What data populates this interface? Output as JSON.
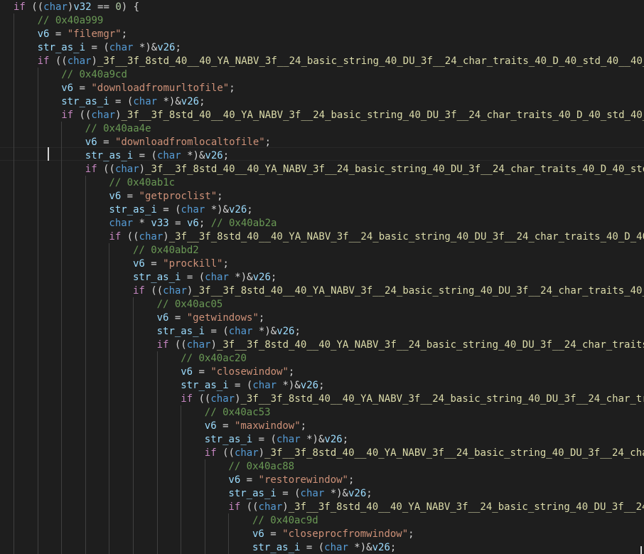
{
  "editor": {
    "colors": {
      "background": "#1e1e1e",
      "keyword": "#c586c0",
      "type": "#569cd6",
      "variable": "#9cdcfe",
      "string": "#ce9178",
      "number": "#b5cea8",
      "comment": "#6a9955",
      "function": "#dcdcaa"
    },
    "lines": [
      [
        {
          "k": "kw",
          "t": "if"
        },
        {
          "k": "p",
          "t": " (("
        },
        {
          "k": "ty",
          "t": "char"
        },
        {
          "k": "p",
          "t": ")"
        },
        {
          "k": "var",
          "t": "v32"
        },
        {
          "k": "p",
          "t": " == "
        },
        {
          "k": "num",
          "t": "0"
        },
        {
          "k": "p",
          "t": ") {"
        }
      ],
      [
        {
          "k": "cmt",
          "t": "// 0x40a999"
        }
      ],
      [
        {
          "k": "var",
          "t": "v6"
        },
        {
          "k": "p",
          "t": " = "
        },
        {
          "k": "str",
          "t": "\"filemgr\""
        },
        {
          "k": "p",
          "t": ";"
        }
      ],
      [
        {
          "k": "var",
          "t": "str_as_i"
        },
        {
          "k": "p",
          "t": " = ("
        },
        {
          "k": "ty",
          "t": "char"
        },
        {
          "k": "p",
          "t": " *)&"
        },
        {
          "k": "var",
          "t": "v26"
        },
        {
          "k": "p",
          "t": ";"
        }
      ],
      [
        {
          "k": "kw",
          "t": "if"
        },
        {
          "k": "p",
          "t": " (("
        },
        {
          "k": "ty",
          "t": "char"
        },
        {
          "k": "p",
          "t": ")"
        },
        {
          "k": "fn",
          "t": "_3f__3f_8std_40__40_YA_NABV_3f__24_basic_string_40_DU_3f__24_char_traits_40_D_40_std_40__40_"
        }
      ],
      [
        {
          "k": "cmt",
          "t": "// 0x40a9cd"
        }
      ],
      [
        {
          "k": "var",
          "t": "v6"
        },
        {
          "k": "p",
          "t": " = "
        },
        {
          "k": "str",
          "t": "\"downloadfromurltofile\""
        },
        {
          "k": "p",
          "t": ";"
        }
      ],
      [
        {
          "k": "var",
          "t": "str_as_i"
        },
        {
          "k": "p",
          "t": " = ("
        },
        {
          "k": "ty",
          "t": "char"
        },
        {
          "k": "p",
          "t": " *)&"
        },
        {
          "k": "var",
          "t": "v26"
        },
        {
          "k": "p",
          "t": ";"
        }
      ],
      [
        {
          "k": "kw",
          "t": "if"
        },
        {
          "k": "p",
          "t": " (("
        },
        {
          "k": "ty",
          "t": "char"
        },
        {
          "k": "p",
          "t": ")"
        },
        {
          "k": "fn",
          "t": "_3f__3f_8std_40__40_YA_NABV_3f__24_basic_string_40_DU_3f__24_char_traits_40_D_40_std_40_"
        }
      ],
      [
        {
          "k": "cmt",
          "t": "// 0x40aa4e"
        }
      ],
      [
        {
          "k": "var",
          "t": "v6"
        },
        {
          "k": "p",
          "t": " = "
        },
        {
          "k": "str",
          "t": "\"downloadfromlocaltofile\""
        },
        {
          "k": "p",
          "t": ";"
        }
      ],
      [
        {
          "k": "var",
          "t": "str_as_i"
        },
        {
          "k": "p",
          "t": " = ("
        },
        {
          "k": "ty",
          "t": "char"
        },
        {
          "k": "p",
          "t": " *)&"
        },
        {
          "k": "var",
          "t": "v26"
        },
        {
          "k": "p",
          "t": ";"
        }
      ],
      [
        {
          "k": "kw",
          "t": "if"
        },
        {
          "k": "p",
          "t": " (("
        },
        {
          "k": "ty",
          "t": "char"
        },
        {
          "k": "p",
          "t": ")"
        },
        {
          "k": "fn",
          "t": "_3f__3f_8std_40__40_YA_NABV_3f__24_basic_string_40_DU_3f__24_char_traits_40_D_40_sto"
        }
      ],
      [
        {
          "k": "cmt",
          "t": "// 0x40ab1c"
        }
      ],
      [
        {
          "k": "var",
          "t": "v6"
        },
        {
          "k": "p",
          "t": " = "
        },
        {
          "k": "str",
          "t": "\"getproclist\""
        },
        {
          "k": "p",
          "t": ";"
        }
      ],
      [
        {
          "k": "var",
          "t": "str_as_i"
        },
        {
          "k": "p",
          "t": " = ("
        },
        {
          "k": "ty",
          "t": "char"
        },
        {
          "k": "p",
          "t": " *)&"
        },
        {
          "k": "var",
          "t": "v26"
        },
        {
          "k": "p",
          "t": ";"
        }
      ],
      [
        {
          "k": "ty",
          "t": "char"
        },
        {
          "k": "p",
          "t": " * "
        },
        {
          "k": "var",
          "t": "v33"
        },
        {
          "k": "p",
          "t": " = "
        },
        {
          "k": "var",
          "t": "v6"
        },
        {
          "k": "p",
          "t": "; "
        },
        {
          "k": "cmt",
          "t": "// 0x40ab2a"
        }
      ],
      [
        {
          "k": "kw",
          "t": "if"
        },
        {
          "k": "p",
          "t": " (("
        },
        {
          "k": "ty",
          "t": "char"
        },
        {
          "k": "p",
          "t": ")"
        },
        {
          "k": "fn",
          "t": "_3f__3f_8std_40__40_YA_NABV_3f__24_basic_string_40_DU_3f__24_char_traits_40_D_40"
        }
      ],
      [
        {
          "k": "cmt",
          "t": "// 0x40abd2"
        }
      ],
      [
        {
          "k": "var",
          "t": "v6"
        },
        {
          "k": "p",
          "t": " = "
        },
        {
          "k": "str",
          "t": "\"prockill\""
        },
        {
          "k": "p",
          "t": ";"
        }
      ],
      [
        {
          "k": "var",
          "t": "str_as_i"
        },
        {
          "k": "p",
          "t": " = ("
        },
        {
          "k": "ty",
          "t": "char"
        },
        {
          "k": "p",
          "t": " *)&"
        },
        {
          "k": "var",
          "t": "v26"
        },
        {
          "k": "p",
          "t": ";"
        }
      ],
      [
        {
          "k": "kw",
          "t": "if"
        },
        {
          "k": "p",
          "t": " (("
        },
        {
          "k": "ty",
          "t": "char"
        },
        {
          "k": "p",
          "t": ")"
        },
        {
          "k": "fn",
          "t": "_3f__3f_8std_40__40_YA_NABV_3f__24_basic_string_40_DU_3f__24_char_traits_40_"
        }
      ],
      [
        {
          "k": "cmt",
          "t": "// 0x40ac05"
        }
      ],
      [
        {
          "k": "var",
          "t": "v6"
        },
        {
          "k": "p",
          "t": " = "
        },
        {
          "k": "str",
          "t": "\"getwindows\""
        },
        {
          "k": "p",
          "t": ";"
        }
      ],
      [
        {
          "k": "var",
          "t": "str_as_i"
        },
        {
          "k": "p",
          "t": " = ("
        },
        {
          "k": "ty",
          "t": "char"
        },
        {
          "k": "p",
          "t": " *)&"
        },
        {
          "k": "var",
          "t": "v26"
        },
        {
          "k": "p",
          "t": ";"
        }
      ],
      [
        {
          "k": "kw",
          "t": "if"
        },
        {
          "k": "p",
          "t": " (("
        },
        {
          "k": "ty",
          "t": "char"
        },
        {
          "k": "p",
          "t": ")"
        },
        {
          "k": "fn",
          "t": "_3f__3f_8std_40__40_YA_NABV_3f__24_basic_string_40_DU_3f__24_char_traits"
        }
      ],
      [
        {
          "k": "cmt",
          "t": "// 0x40ac20"
        }
      ],
      [
        {
          "k": "var",
          "t": "v6"
        },
        {
          "k": "p",
          "t": " = "
        },
        {
          "k": "str",
          "t": "\"closewindow\""
        },
        {
          "k": "p",
          "t": ";"
        }
      ],
      [
        {
          "k": "var",
          "t": "str_as_i"
        },
        {
          "k": "p",
          "t": " = ("
        },
        {
          "k": "ty",
          "t": "char"
        },
        {
          "k": "p",
          "t": " *)&"
        },
        {
          "k": "var",
          "t": "v26"
        },
        {
          "k": "p",
          "t": ";"
        }
      ],
      [
        {
          "k": "kw",
          "t": "if"
        },
        {
          "k": "p",
          "t": " (("
        },
        {
          "k": "ty",
          "t": "char"
        },
        {
          "k": "p",
          "t": ")"
        },
        {
          "k": "fn",
          "t": "_3f__3f_8std_40__40_YA_NABV_3f__24_basic_string_40_DU_3f__24_char_tr"
        }
      ],
      [
        {
          "k": "cmt",
          "t": "// 0x40ac53"
        }
      ],
      [
        {
          "k": "var",
          "t": "v6"
        },
        {
          "k": "p",
          "t": " = "
        },
        {
          "k": "str",
          "t": "\"maxwindow\""
        },
        {
          "k": "p",
          "t": ";"
        }
      ],
      [
        {
          "k": "var",
          "t": "str_as_i"
        },
        {
          "k": "p",
          "t": " = ("
        },
        {
          "k": "ty",
          "t": "char"
        },
        {
          "k": "p",
          "t": " *)&"
        },
        {
          "k": "var",
          "t": "v26"
        },
        {
          "k": "p",
          "t": ";"
        }
      ],
      [
        {
          "k": "kw",
          "t": "if"
        },
        {
          "k": "p",
          "t": " (("
        },
        {
          "k": "ty",
          "t": "char"
        },
        {
          "k": "p",
          "t": ")"
        },
        {
          "k": "fn",
          "t": "_3f__3f_8std_40__40_YA_NABV_3f__24_basic_string_40_DU_3f__24_cha"
        }
      ],
      [
        {
          "k": "cmt",
          "t": "// 0x40ac88"
        }
      ],
      [
        {
          "k": "var",
          "t": "v6"
        },
        {
          "k": "p",
          "t": " = "
        },
        {
          "k": "str",
          "t": "\"restorewindow\""
        },
        {
          "k": "p",
          "t": ";"
        }
      ],
      [
        {
          "k": "var",
          "t": "str_as_i"
        },
        {
          "k": "p",
          "t": " = ("
        },
        {
          "k": "ty",
          "t": "char"
        },
        {
          "k": "p",
          "t": " *)&"
        },
        {
          "k": "var",
          "t": "v26"
        },
        {
          "k": "p",
          "t": ";"
        }
      ],
      [
        {
          "k": "kw",
          "t": "if"
        },
        {
          "k": "p",
          "t": " (("
        },
        {
          "k": "ty",
          "t": "char"
        },
        {
          "k": "p",
          "t": ")"
        },
        {
          "k": "fn",
          "t": "_3f__3f_8std_40__40_YA_NABV_3f__24_basic_string_40_DU_3f__24_"
        }
      ],
      [
        {
          "k": "cmt",
          "t": "// 0x40ac9d"
        }
      ],
      [
        {
          "k": "var",
          "t": "v6"
        },
        {
          "k": "p",
          "t": " = "
        },
        {
          "k": "str",
          "t": "\"closeprocfromwindow\""
        },
        {
          "k": "p",
          "t": ";"
        }
      ],
      [
        {
          "k": "var",
          "t": "str_as_i"
        },
        {
          "k": "p",
          "t": " = ("
        },
        {
          "k": "ty",
          "t": "char"
        },
        {
          "k": "p",
          "t": " *)&"
        },
        {
          "k": "var",
          "t": "v26"
        },
        {
          "k": "p",
          "t": ";"
        }
      ]
    ]
  }
}
